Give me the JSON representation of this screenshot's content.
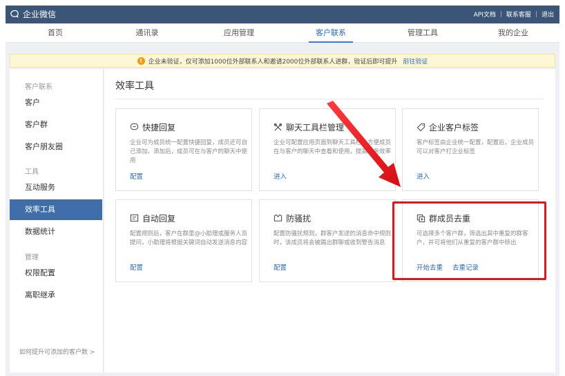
{
  "app": {
    "name": "企业微信",
    "top_links": [
      "API文档",
      "联系客服",
      "退出"
    ]
  },
  "nav": {
    "items": [
      {
        "label": "首页",
        "active": false
      },
      {
        "label": "通讯录",
        "active": false
      },
      {
        "label": "应用管理",
        "active": false
      },
      {
        "label": "客户联系",
        "active": true
      },
      {
        "label": "管理工具",
        "active": false
      },
      {
        "label": "我的企业",
        "active": false
      }
    ]
  },
  "notice": {
    "text": "企业未验证，仅可添加1000位外部联系人和邀请2000位外部联系人进群，验证后即可提升",
    "link": "前往验证",
    "color": "#f19a1a"
  },
  "sidebar": {
    "section_customer": "客户联系",
    "item_customer": "客户",
    "item_group": "客户群",
    "item_moments": "客户朋友圈",
    "section_tools": "工具",
    "item_interactive": "互动服务",
    "item_efficiency": "效率工具",
    "item_stats": "数据统计",
    "section_manage": "管理",
    "item_permission": "权限配置",
    "item_resign": "离职继承",
    "footer_link": "如何提升可添加的客户数 >",
    "active_color": "#3f6ea8"
  },
  "main": {
    "title": "效率工具",
    "cards": [
      {
        "title": "快捷回复",
        "icon": "message-icon",
        "desc": "企业可为成员统一配置快捷回复，成员还可自己添加，添加后，成员可在与客户的聊天中使用",
        "links": [
          "配置"
        ]
      },
      {
        "title": "聊天工具栏管理",
        "icon": "tools-icon",
        "desc": "企业可配置应用页面到聊天工具栏，方便成员在与客户的聊天中查看和使用，提高服务效率",
        "links": [
          "进入"
        ]
      },
      {
        "title": "企业客户标签",
        "icon": "tag-icon",
        "desc": "客户标签由企业统一配置，配置后，企业成员可以对客户打企业标签",
        "links": [
          "进入"
        ]
      },
      {
        "title": "自动回复",
        "icon": "auto-reply-icon",
        "desc": "配置规则后，客户在群里@小助理或服务人员提问，小助理将根据关键词自动发送消息内容",
        "links": [
          "配置"
        ]
      },
      {
        "title": "防骚扰",
        "icon": "shield-icon",
        "desc": "配置防骚扰规则，群客户发送的消息命中规则时，该成员将会被踢出群聊或收到警告消息",
        "links": [
          "配置"
        ]
      },
      {
        "title": "群成员去重",
        "icon": "dedupe-icon",
        "desc": "可选择多个客户群，筛选出其中重复的群客户，并可将他们从重复的客户群中移出",
        "links": [
          "开始去重",
          "去重记录"
        ]
      }
    ]
  },
  "colors": {
    "header": "#3a5576",
    "link": "#2d6bb5",
    "highlight": "#e0161b"
  }
}
